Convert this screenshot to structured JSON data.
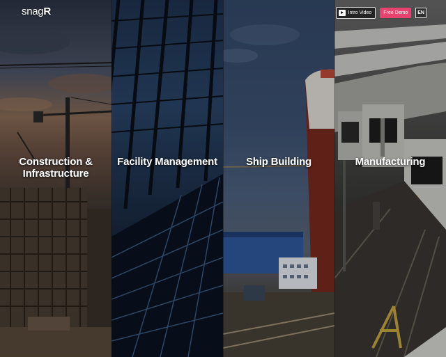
{
  "header": {
    "logo_prefix": "snag",
    "logo_suffix": "R",
    "intro_label": "Intro Video",
    "demo_label": "Free Demo",
    "lang_label": "EN"
  },
  "panels": [
    {
      "label_line1": "Construction &",
      "label_line2": "Infrastructure"
    },
    {
      "label_line1": "Facility Management",
      "label_line2": ""
    },
    {
      "label_line1": "Ship Building",
      "label_line2": ""
    },
    {
      "label_line1": "Manufacturing",
      "label_line2": ""
    }
  ],
  "colors": {
    "demo": "#e8436e"
  },
  "icons": {
    "play": "play-icon"
  }
}
